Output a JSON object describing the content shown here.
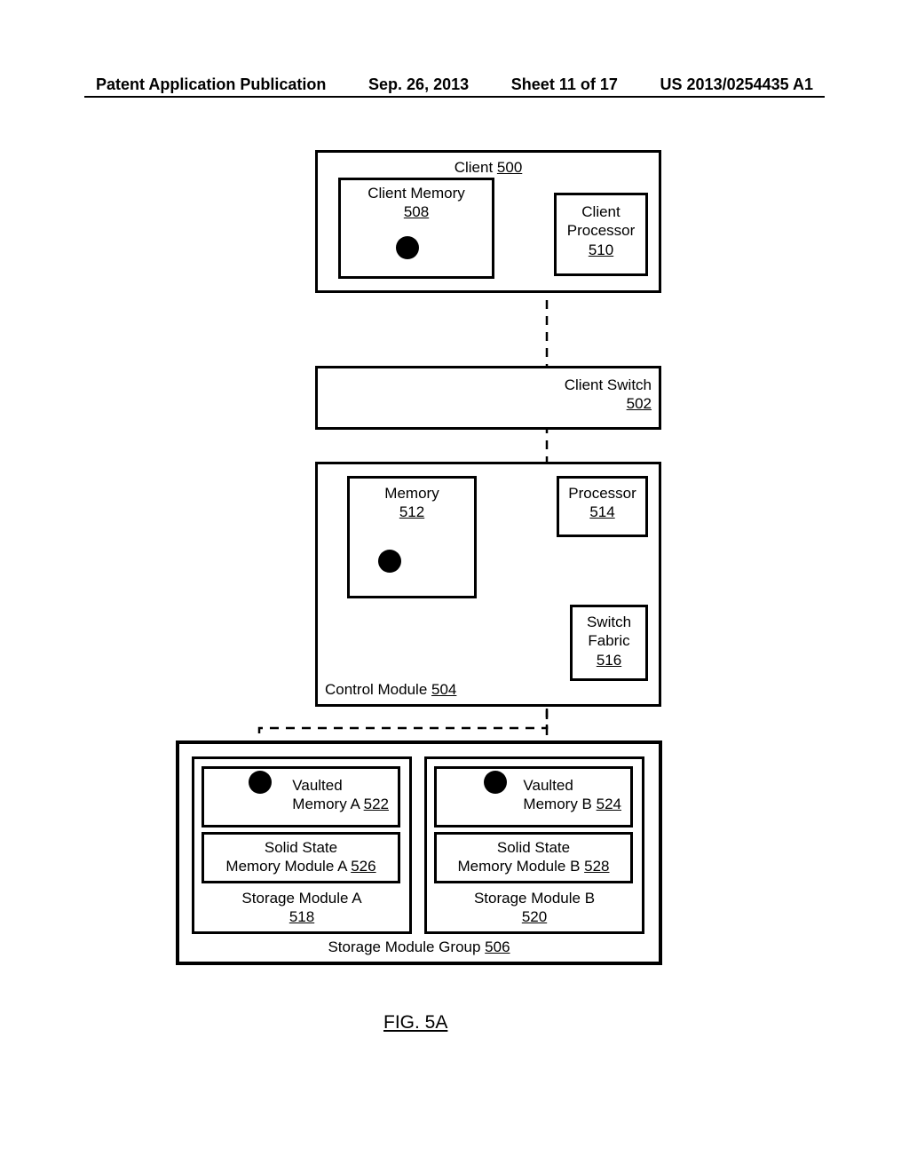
{
  "header": {
    "pub_type": "Patent Application Publication",
    "date": "Sep. 26, 2013",
    "sheet": "Sheet 11 of 17",
    "pub_number": "US 2013/0254435 A1"
  },
  "figure_caption": "FIG. 5A",
  "client": {
    "title": "Client",
    "ref": "500",
    "memory_title": "Client Memory",
    "memory_ref": "508",
    "processor_l1": "Client",
    "processor_l2": "Processor",
    "processor_ref": "510"
  },
  "client_switch": {
    "title": "Client Switch",
    "ref": "502"
  },
  "control_module": {
    "title": "Control Module",
    "ref": "504",
    "memory_title": "Memory",
    "memory_ref": "512",
    "processor_title": "Processor",
    "processor_ref": "514",
    "switch_l1": "Switch",
    "switch_l2": "Fabric",
    "switch_ref": "516"
  },
  "storage_group": {
    "title": "Storage Module Group",
    "ref": "506",
    "a": {
      "module_title": "Storage Module A",
      "module_ref": "518",
      "vaulted_l1": "Vaulted",
      "vaulted_l2": "Memory A",
      "vaulted_ref": "522",
      "ssm_l1": "Solid State",
      "ssm_l2": "Memory Module A",
      "ssm_ref": "526"
    },
    "b": {
      "module_title": "Storage Module B",
      "module_ref": "520",
      "vaulted_l1": "Vaulted",
      "vaulted_l2": "Memory B",
      "vaulted_ref": "524",
      "ssm_l1": "Solid State",
      "ssm_l2": "Memory Module B",
      "ssm_ref": "528"
    }
  }
}
